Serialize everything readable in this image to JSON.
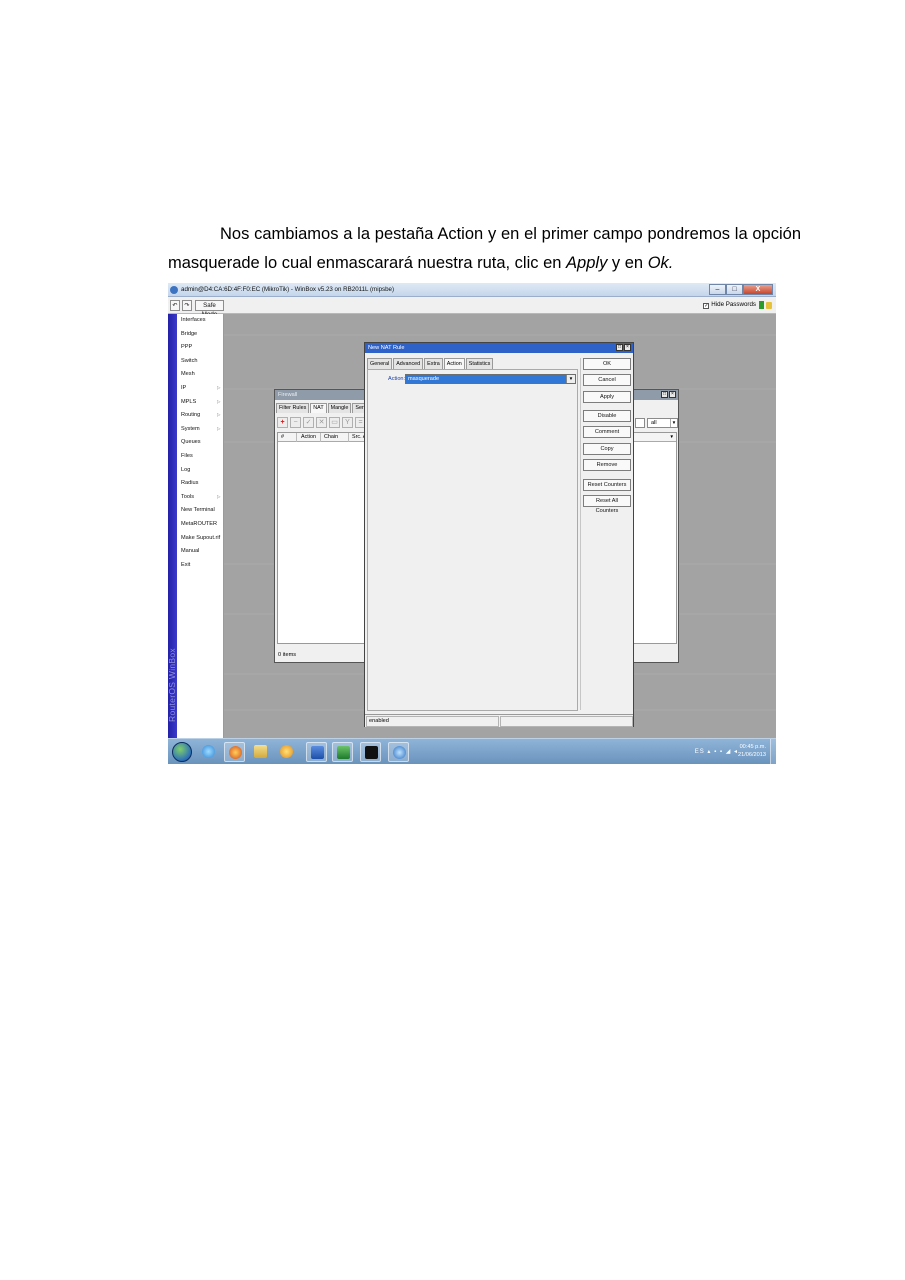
{
  "paragraph": {
    "part1": "Nos cambiamos a la pestaña Action y en el primer campo pondremos la opción masquerade lo cual enmascarará nuestra ruta, clic en ",
    "apply": "Apply",
    "part2": " y en ",
    "ok": "Ok.",
    "part3": ""
  },
  "winbox": {
    "title": "admin@D4:CA:6D:4F:F0:EC (MikroTik) - WinBox v5.23 on RB2011L (mipsbe)",
    "win_buttons": {
      "minimize": "–",
      "maximize": "□",
      "close": "X"
    },
    "toolbar": {
      "undo": "↶",
      "redo": "↷",
      "safe_mode": "Safe Mode",
      "hide_passwords": "Hide Passwords",
      "hide_passwords_checked": "✓"
    },
    "brand": "RouterOS WinBox",
    "menu": [
      {
        "label": "Interfaces",
        "arrow": ""
      },
      {
        "label": "Bridge",
        "arrow": ""
      },
      {
        "label": "PPP",
        "arrow": ""
      },
      {
        "label": "Switch",
        "arrow": ""
      },
      {
        "label": "Mesh",
        "arrow": ""
      },
      {
        "label": "IP",
        "arrow": "▷"
      },
      {
        "label": "MPLS",
        "arrow": "▷"
      },
      {
        "label": "Routing",
        "arrow": "▷"
      },
      {
        "label": "System",
        "arrow": "▷"
      },
      {
        "label": "Queues",
        "arrow": ""
      },
      {
        "label": "Files",
        "arrow": ""
      },
      {
        "label": "Log",
        "arrow": ""
      },
      {
        "label": "Radius",
        "arrow": ""
      },
      {
        "label": "Tools",
        "arrow": "▷"
      },
      {
        "label": "New Terminal",
        "arrow": ""
      },
      {
        "label": "MetaROUTER",
        "arrow": ""
      },
      {
        "label": "Make Supout.rif",
        "arrow": ""
      },
      {
        "label": "Manual",
        "arrow": ""
      },
      {
        "label": "Exit",
        "arrow": ""
      }
    ],
    "firewall": {
      "title": "Firewall",
      "restore": "□",
      "close": "×",
      "tabs": [
        "Filter Rules",
        "NAT",
        "Mangle",
        "Service Po"
      ],
      "active_tab": 1,
      "toolbar_icons": [
        "+",
        "−",
        "✓",
        "✕",
        "▭",
        "Y",
        "="
      ],
      "filter_value": "all",
      "columns": [
        "#",
        "Action",
        "Chain",
        "Src. A"
      ],
      "dropdown": "▼",
      "items": "0 items"
    },
    "nat_rule": {
      "title": "New NAT Rule",
      "restore": "□",
      "close": "×",
      "tabs": [
        "General",
        "Advanced",
        "Extra",
        "Action",
        "Statistics"
      ],
      "active_tab": 3,
      "action_label": "Action:",
      "action_value": "masquerade",
      "dropdown": "▼",
      "buttons": [
        "OK",
        "Cancel",
        "Apply",
        "Disable",
        "Comment",
        "Copy",
        "Remove",
        "Reset Counters",
        "Reset All Counters"
      ],
      "status": "enabled",
      "status2": ""
    },
    "taskbar": {
      "tray": "ES  ▴ ▪ ▪ ◢ ◂",
      "time": "00:45 p.m.",
      "date": "21/06/2013"
    }
  }
}
